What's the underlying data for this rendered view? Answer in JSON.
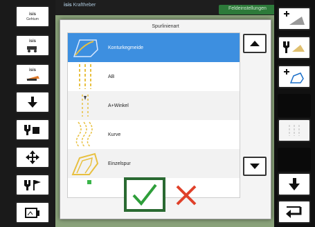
{
  "topbar": {
    "tab1_label": "Kraftheber",
    "tab2_label": "Feldeinstellungen",
    "brand": "isis"
  },
  "leftbar": {
    "btn1_brand": "isis",
    "btn1_sub": "Gehtum",
    "btn2_brand": "isis",
    "btn3_brand": "isis"
  },
  "dialog": {
    "title": "Spurlinienart",
    "items": [
      {
        "label": "Konturkegmeide"
      },
      {
        "label": "AB"
      },
      {
        "label": "A+Winkel"
      },
      {
        "label": "Kurve"
      },
      {
        "label": "Einzelspur"
      }
    ],
    "selected_index": 0
  },
  "colors": {
    "selection": "#3d8fe0",
    "ok_border": "#2a6a32",
    "ok_check": "#2e9e3a",
    "cancel_x": "#e0412a"
  }
}
